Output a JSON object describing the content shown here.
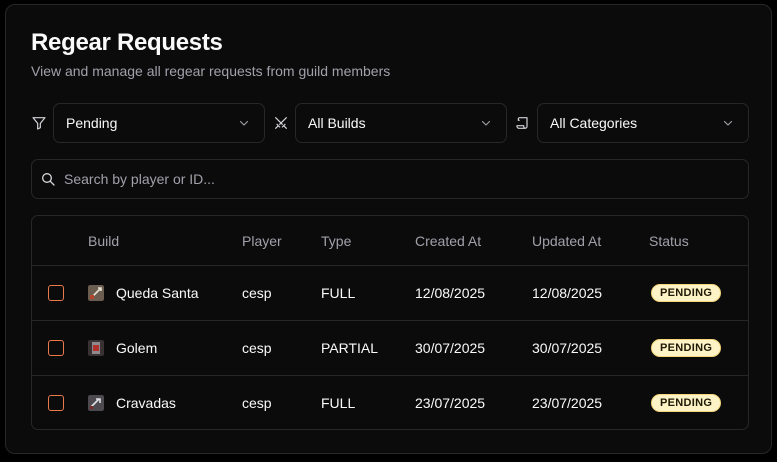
{
  "header": {
    "title": "Regear Requests",
    "subtitle": "View and manage all regear requests from guild members"
  },
  "filters": {
    "status": {
      "icon": "filter-icon",
      "value": "Pending"
    },
    "build": {
      "icon": "swords-icon",
      "value": "All Builds"
    },
    "category": {
      "icon": "scroll-icon",
      "value": "All Categories"
    }
  },
  "search": {
    "placeholder": "Search by player or ID..."
  },
  "table": {
    "headers": {
      "build": "Build",
      "player": "Player",
      "type": "Type",
      "created": "Created At",
      "updated": "Updated At",
      "status": "Status"
    },
    "rows": [
      {
        "build": "Queda Santa",
        "player": "cesp",
        "type": "FULL",
        "created": "12/08/2025",
        "updated": "12/08/2025",
        "status": "PENDING"
      },
      {
        "build": "Golem",
        "player": "cesp",
        "type": "PARTIAL",
        "created": "30/07/2025",
        "updated": "30/07/2025",
        "status": "PENDING"
      },
      {
        "build": "Cravadas",
        "player": "cesp",
        "type": "FULL",
        "created": "23/07/2025",
        "updated": "23/07/2025",
        "status": "PENDING"
      }
    ]
  },
  "colors": {
    "checkbox": "#ea7a4a",
    "badge_bg": "#fef3c7",
    "border": "#27272a"
  }
}
